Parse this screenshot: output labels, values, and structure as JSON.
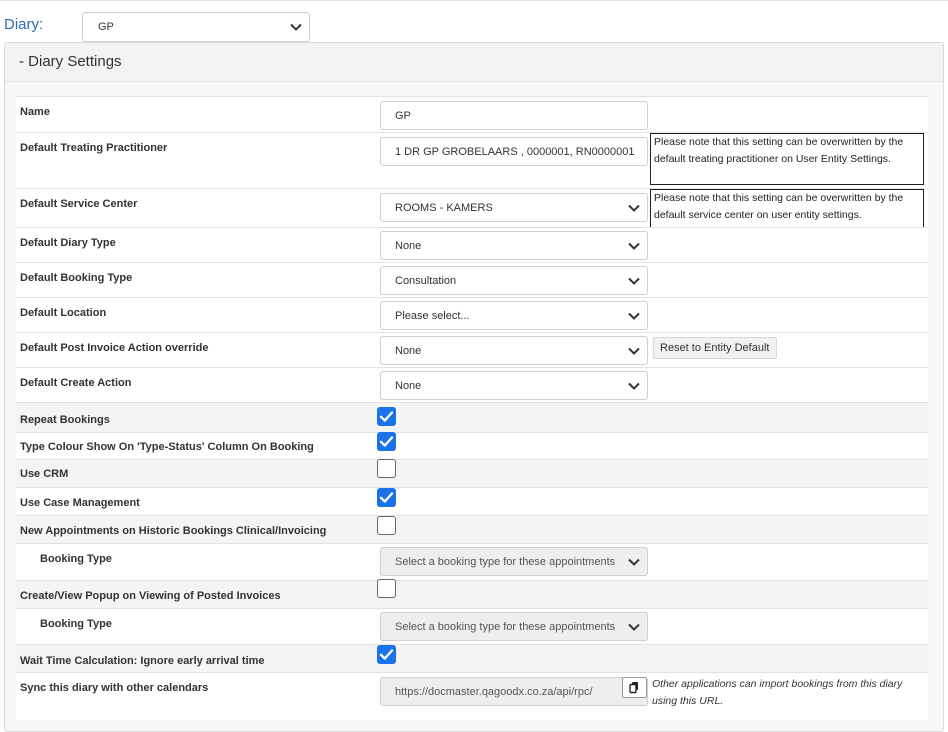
{
  "diary": {
    "label": "Diary:",
    "selected": "GP"
  },
  "panel": {
    "title": "- Diary Settings"
  },
  "fields": {
    "name": {
      "label": "Name",
      "value": "GP"
    },
    "treating_practitioner": {
      "label": "Default Treating Practitioner",
      "value": "1 DR GP GROBELAARS , 0000001, RN0000001",
      "note": "Please note that this setting can be overwritten by the default treating practitioner on User Entity Settings."
    },
    "service_center": {
      "label": "Default Service Center",
      "value": "ROOMS - KAMERS",
      "note": "Please note that this setting can be overwritten by the default service center on user entity settings."
    },
    "diary_type": {
      "label": "Default Diary Type",
      "value": "None"
    },
    "booking_type": {
      "label": "Default Booking Type",
      "value": "Consultation"
    },
    "location": {
      "label": "Default Location",
      "value": "Please select..."
    },
    "post_invoice": {
      "label": "Default Post Invoice Action override",
      "value": "None",
      "reset_label": "Reset to Entity Default"
    },
    "create_action": {
      "label": "Default Create Action",
      "value": "None"
    },
    "repeat_bookings": {
      "label": "Repeat Bookings",
      "checked": true
    },
    "type_colour": {
      "label": "Type Colour Show On 'Type-Status' Column On Booking",
      "checked": true
    },
    "use_crm": {
      "label": "Use CRM",
      "checked": false
    },
    "use_case_management": {
      "label": "Use Case Management",
      "checked": true
    },
    "new_appointments": {
      "label": "New Appointments on Historic Bookings Clinical/Invoicing",
      "checked": false
    },
    "new_appointments_booking_type": {
      "label": "Booking Type",
      "value": "Select a booking type for these appointments"
    },
    "create_view_popup": {
      "label": "Create/View Popup on Viewing of Posted Invoices",
      "checked": false
    },
    "popup_booking_type": {
      "label": "Booking Type",
      "value": "Select a booking type for these appointments"
    },
    "wait_time": {
      "label": "Wait Time Calculation: Ignore early arrival time",
      "checked": true
    },
    "sync": {
      "label": "Sync this diary with other calendars",
      "value": "https://docmaster.qagoodx.co.za/api/rpc/",
      "note": "Other applications can import bookings from this diary using this URL."
    }
  },
  "colors": {
    "accent": "#1a73e8",
    "label_blue": "#2a6db5"
  },
  "icons": {
    "dropdown": "chevron-down-icon",
    "copy": "copy-icon",
    "checkbox": "checkmark-icon"
  }
}
